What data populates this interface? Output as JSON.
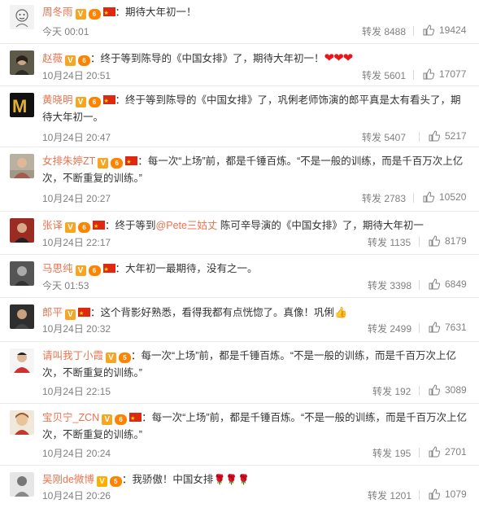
{
  "comments": [
    {
      "user": "周冬雨",
      "text": "期待大年初一！",
      "time": "今天 00:01",
      "repost": "转发 8488",
      "likes": "19424",
      "avatar_color": "#f0f0f0",
      "extra": ""
    },
    {
      "user": "赵薇",
      "text": "终于等到陈导的《中国女排》了，期待大年初一！",
      "time": "10月24日 20:51",
      "repost": "转发 5601",
      "likes": "17077",
      "avatar_color": "#6a6a5a",
      "extra": "hearts"
    },
    {
      "user": "黄晓明",
      "text": "终于等到陈导的《中国女排》了，巩俐老师饰演的郎平真是太有看头了，期待大年初一。",
      "time": "10月24日 20:47",
      "repost": "转发 5407",
      "likes": "5217",
      "avatar_color": "#1a1a1a",
      "extra": ""
    },
    {
      "user": "女排朱婷ZT",
      "text": "每一次“上场”前，都是千锤百炼。“不是一般的训练，而是千百万次上亿次，不断重复的训练。”",
      "time": "10月24日 20:27",
      "repost": "转发 2783",
      "likes": "10520",
      "avatar_color": "#c9a58a",
      "extra": ""
    },
    {
      "user": "张译",
      "text_pre": "终于等到",
      "mention": "@Pete三姑丈",
      "text_post": " 陈可辛导演的《中国女排》了，期待大年初一",
      "time": "10月24日 22:17",
      "repost": "转发 1135",
      "likes": "8179",
      "avatar_color": "#b03a2e",
      "extra": ""
    },
    {
      "user": "马思纯",
      "text": "大年初一最期待，没有之一。",
      "time": "今天 01:53",
      "repost": "转发 3398",
      "likes": "6849",
      "avatar_color": "#4a4a4a",
      "extra": ""
    },
    {
      "user": "郎平",
      "text": "这个背影好熟悉，看得我都有点恍惚了。真像！巩俐",
      "time": "10月24日 20:32",
      "repost": "转发 2499",
      "likes": "7631",
      "avatar_color": "#3a3a3a",
      "extra": "thumb"
    },
    {
      "user": "请叫我丁小霞",
      "text": "每一次“上场”前，都是千锤百炼。“不是一般的训练，而是千百万次上亿次，不断重复的训练。”",
      "time": "10月24日 22:15",
      "repost": "转发 192",
      "likes": "3089",
      "avatar_color": "#d33a3a",
      "extra": ""
    },
    {
      "user": "宝贝宁_ZCN",
      "text": "每一次“上场”前，都是千锤百炼。“不是一般的训练，而是千百万次上亿次，不断重复的训练。”",
      "time": "10月24日 20:24",
      "repost": "转发 195",
      "likes": "2701",
      "avatar_color": "#e8c8a0",
      "extra": ""
    },
    {
      "user": "吴刚de微博",
      "text": "我骄傲！中国女排",
      "time": "10月24日 20:26",
      "repost": "转发 1201",
      "likes": "1079",
      "avatar_color": "#d8d8d8",
      "extra": "roses"
    }
  ]
}
